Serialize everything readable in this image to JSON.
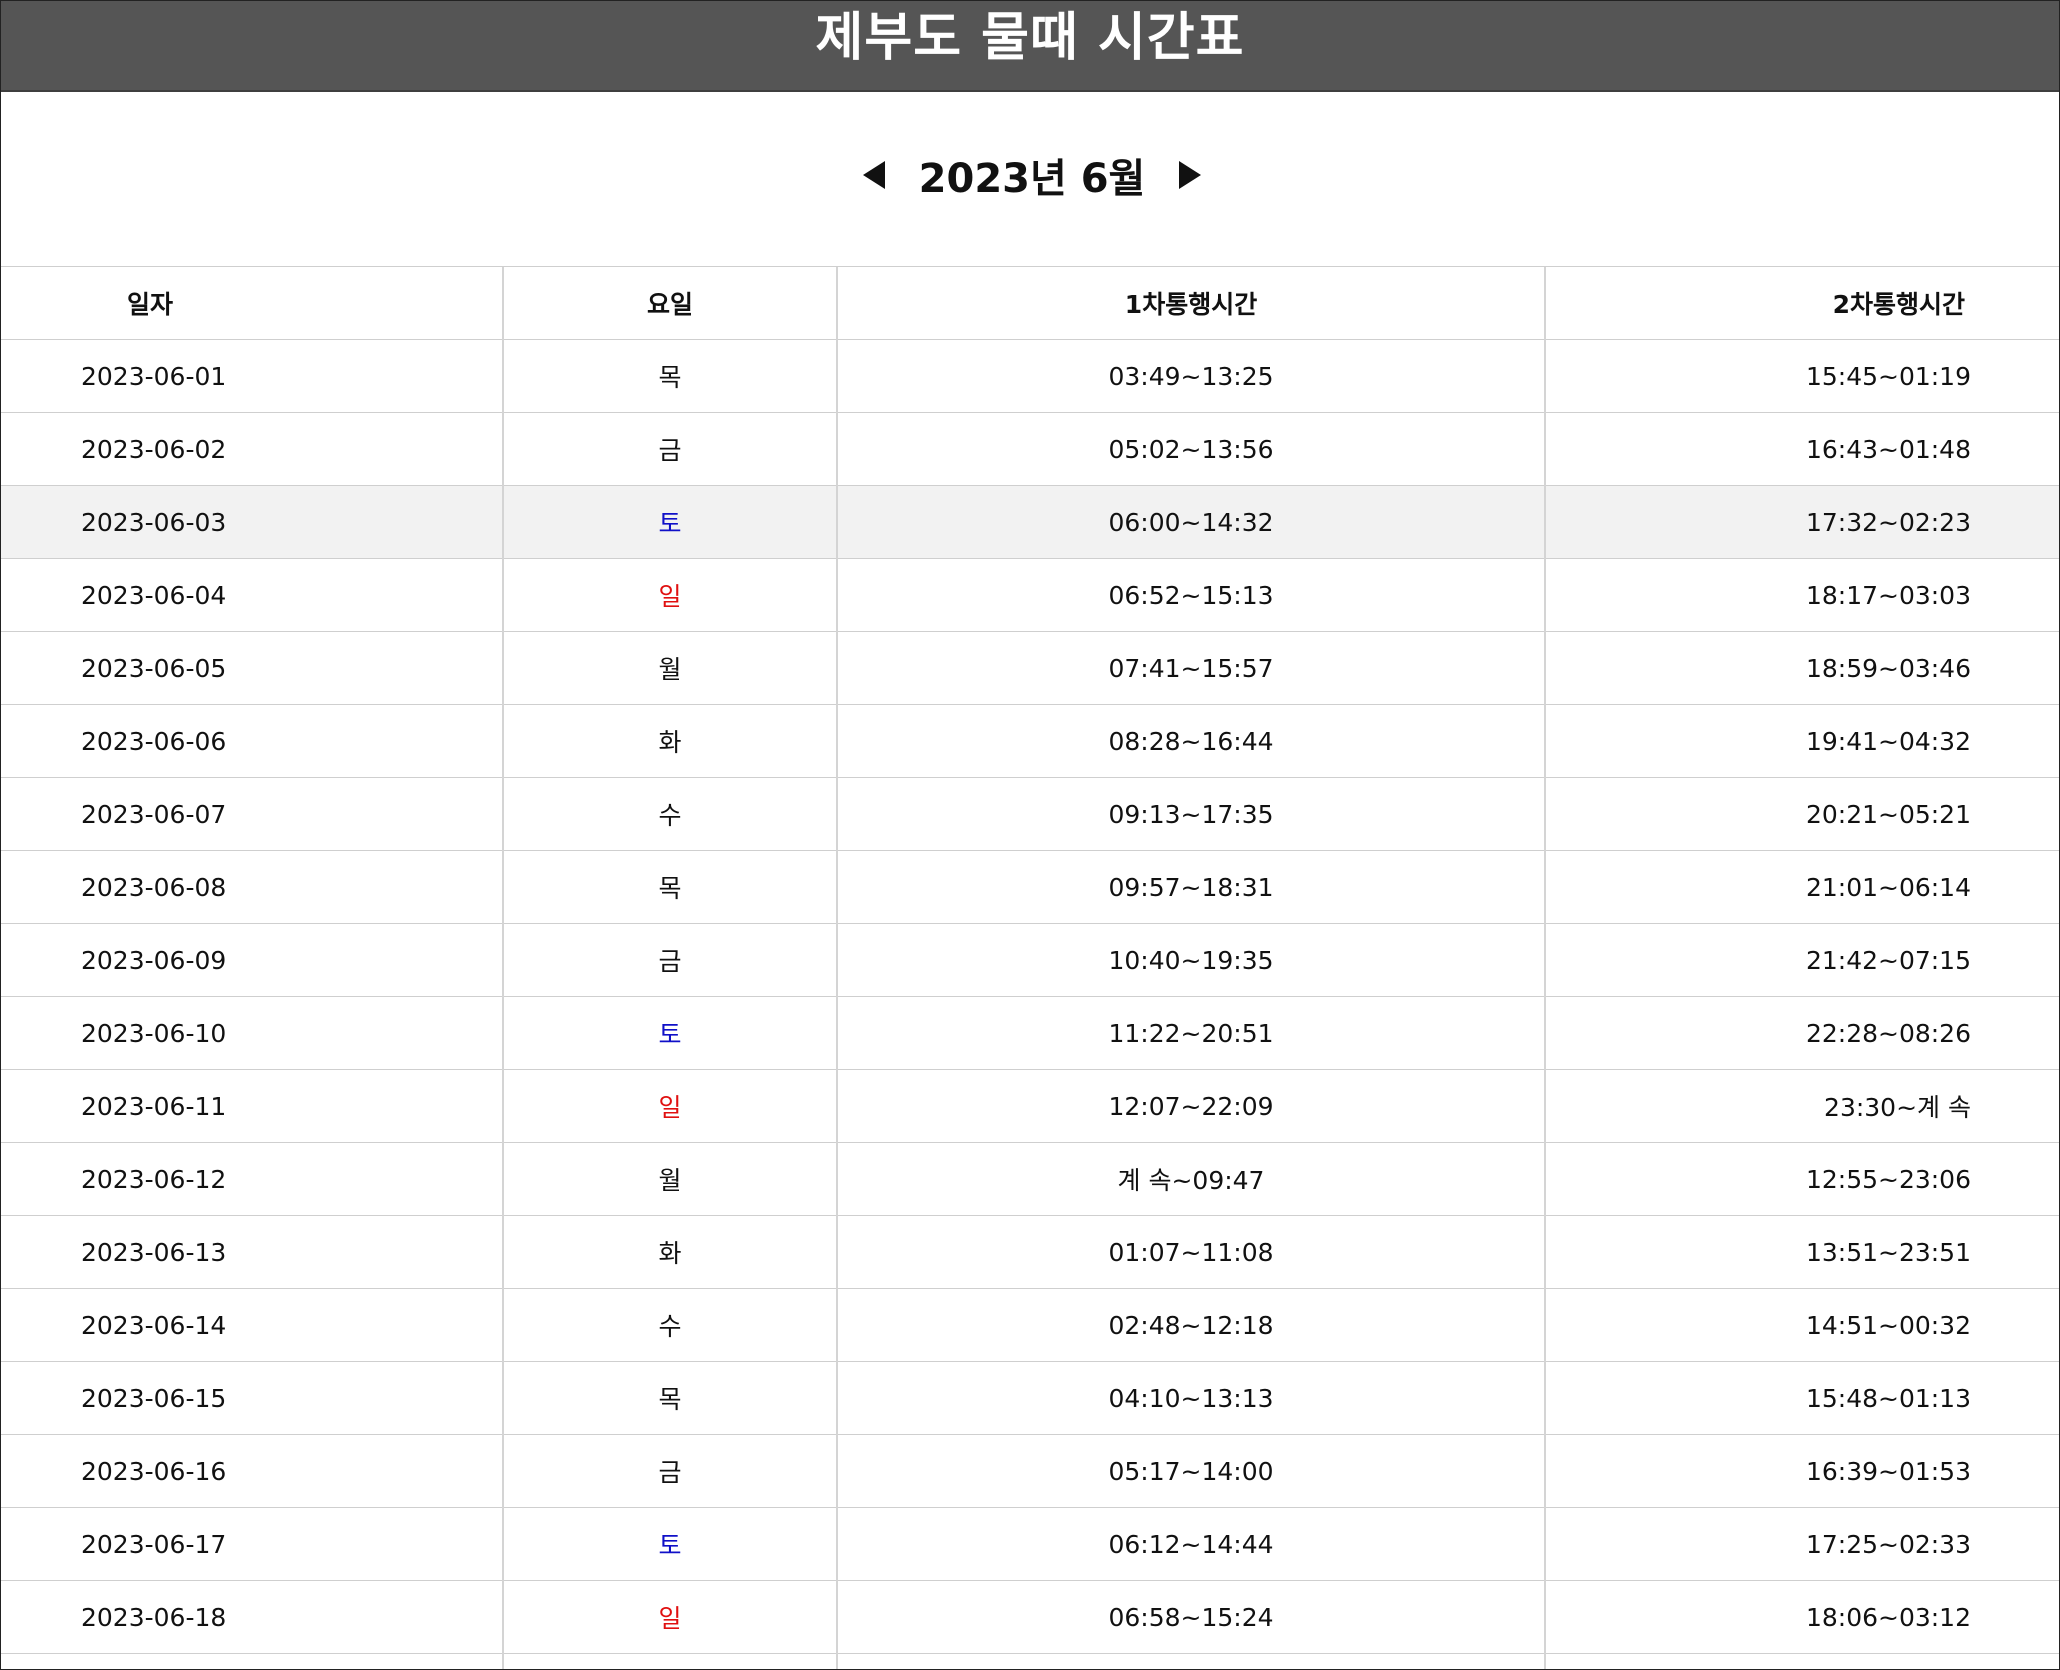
{
  "header": {
    "title": "제부도 물때 시간표"
  },
  "nav": {
    "month_label": "2023년 6월"
  },
  "table": {
    "headers": [
      "일자",
      "요일",
      "1차통행시간",
      "2차통행시간"
    ],
    "rows": [
      {
        "date": "2023-06-01",
        "day": "목",
        "first": "03:49~13:25",
        "second": "15:45~01:19"
      },
      {
        "date": "2023-06-02",
        "day": "금",
        "first": "05:02~13:56",
        "second": "16:43~01:48"
      },
      {
        "date": "2023-06-03",
        "day": "토",
        "first": "06:00~14:32",
        "second": "17:32~02:23"
      },
      {
        "date": "2023-06-04",
        "day": "일",
        "first": "06:52~15:13",
        "second": "18:17~03:03"
      },
      {
        "date": "2023-06-05",
        "day": "월",
        "first": "07:41~15:57",
        "second": "18:59~03:46"
      },
      {
        "date": "2023-06-06",
        "day": "화",
        "first": "08:28~16:44",
        "second": "19:41~04:32"
      },
      {
        "date": "2023-06-07",
        "day": "수",
        "first": "09:13~17:35",
        "second": "20:21~05:21"
      },
      {
        "date": "2023-06-08",
        "day": "목",
        "first": "09:57~18:31",
        "second": "21:01~06:14"
      },
      {
        "date": "2023-06-09",
        "day": "금",
        "first": "10:40~19:35",
        "second": "21:42~07:15"
      },
      {
        "date": "2023-06-10",
        "day": "토",
        "first": "11:22~20:51",
        "second": "22:28~08:26"
      },
      {
        "date": "2023-06-11",
        "day": "일",
        "first": "12:07~22:09",
        "second": "23:30~계 속"
      },
      {
        "date": "2023-06-12",
        "day": "월",
        "first": "계 속~09:47",
        "second": "12:55~23:06"
      },
      {
        "date": "2023-06-13",
        "day": "화",
        "first": "01:07~11:08",
        "second": "13:51~23:51"
      },
      {
        "date": "2023-06-14",
        "day": "수",
        "first": "02:48~12:18",
        "second": "14:51~00:32"
      },
      {
        "date": "2023-06-15",
        "day": "목",
        "first": "04:10~13:13",
        "second": "15:48~01:13"
      },
      {
        "date": "2023-06-16",
        "day": "금",
        "first": "05:17~14:00",
        "second": "16:39~01:53"
      },
      {
        "date": "2023-06-17",
        "day": "토",
        "first": "06:12~14:44",
        "second": "17:25~02:33"
      },
      {
        "date": "2023-06-18",
        "day": "일",
        "first": "06:58~15:24",
        "second": "18:06~03:12"
      }
    ]
  },
  "colors": {
    "header_bg": "#555555",
    "saturday": "#1010c8",
    "sunday": "#e01010",
    "highlight_row": "#f2f2f2"
  }
}
